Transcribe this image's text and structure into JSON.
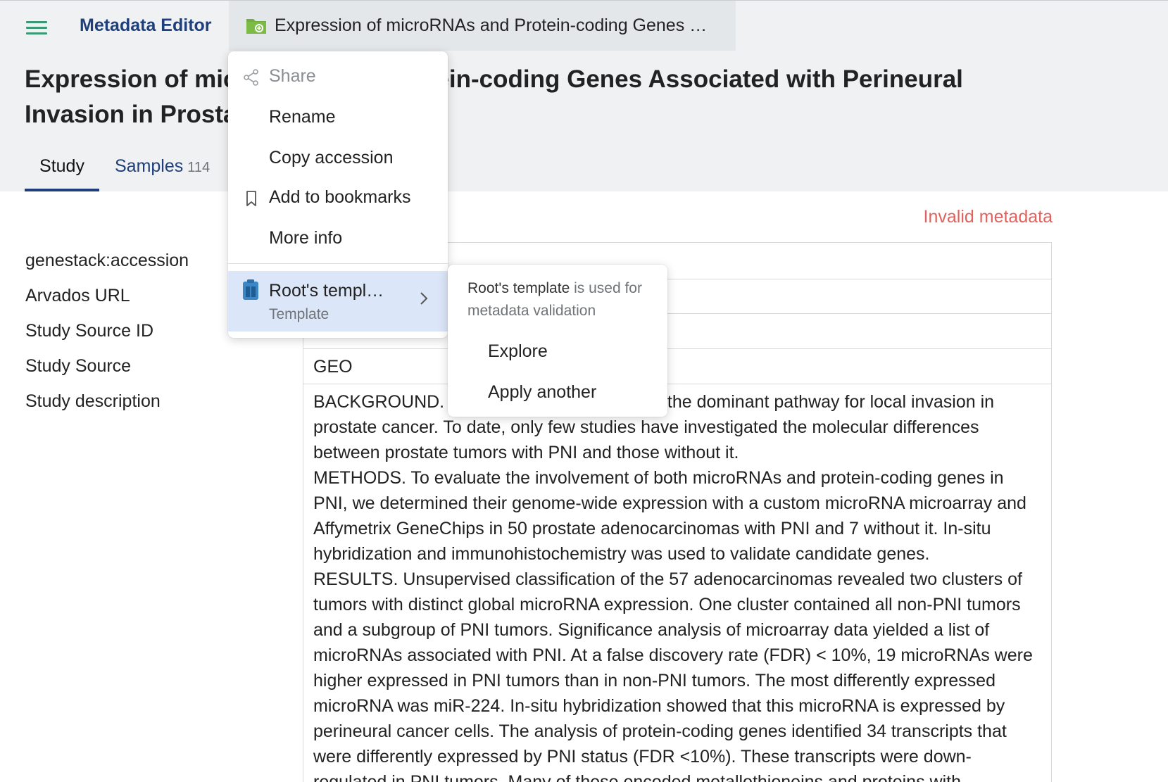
{
  "header": {
    "app_title": "Metadata Editor",
    "file_tab_label": "Expression of microRNAs and Protein-coding Genes …",
    "menu_icon": "hamburger-menu-icon",
    "file_icon": "study-folder-icon"
  },
  "page": {
    "title": "Expression of microRNAs and Protein-coding Genes Associated with Perineural Invasion in Prostate Cancer"
  },
  "tabs": [
    {
      "label": "Study",
      "active": true
    },
    {
      "label": "Samples",
      "count": "114",
      "active": false
    }
  ],
  "status": {
    "invalid_metadata": "Invalid metadata",
    "color": "#e0625e"
  },
  "fields": [
    {
      "label": "genestack:accession",
      "value": ""
    },
    {
      "label": "Arvados URL",
      "value": ""
    },
    {
      "label": "Study Source ID",
      "value": ""
    },
    {
      "label": "Study Source",
      "value": "GEO"
    },
    {
      "label": "Study description",
      "value": "BACKGROUND. Perineural invasion (PNI) is the dominant pathway for local invasion in\nprostate cancer. To date, only few studies have investigated the molecular differences\nbetween prostate tumors with PNI and those without it.\nMETHODS. To evaluate the involvement of both microRNAs and protein-coding genes in\nPNI, we determined their genome-wide expression with a custom microRNA microarray and\nAffymetrix GeneChips in 50 prostate adenocarcinomas with PNI and 7 without it. In-situ\nhybridization and immunohistochemistry was used to validate candidate genes.\nRESULTS. Unsupervised classification of the 57 adenocarcinomas revealed two clusters of\ntumors with distinct global microRNA expression. One cluster contained all non-PNI tumors\nand a subgroup of PNI tumors. Significance analysis of microarray data yielded a list of\nmicroRNAs associated with PNI. At a false discovery rate (FDR) < 10%, 19 microRNAs were\nhigher expressed in PNI tumors than in non-PNI tumors. The most differently expressed\nmicroRNA was miR-224. In-situ hybridization showed that this microRNA is expressed by\nperineural cancer cells. The analysis of protein-coding genes identified 34 transcripts that\nwere differently expressed by PNI status (FDR <10%). These transcripts were down-\nregulated in PNI tumors. Many of these encoded metallothioneins and proteins with"
    }
  ],
  "context_menu": {
    "items": [
      {
        "label": "Share",
        "icon": "share-icon",
        "disabled": true
      },
      {
        "label": "Rename",
        "icon": "",
        "disabled": false
      },
      {
        "label": "Copy accession",
        "icon": "",
        "disabled": false
      },
      {
        "label": "Add to bookmarks",
        "icon": "bookmark-icon",
        "disabled": false
      },
      {
        "label": "More info",
        "icon": "",
        "disabled": false
      }
    ],
    "template": {
      "name": "Root's templ…",
      "subtitle": "Template",
      "icon": "template-icon"
    }
  },
  "submenu": {
    "info_strong": "Root's template",
    "info_rest": " is used for metadata validation",
    "items": [
      "Explore",
      "Apply another"
    ]
  },
  "colors": {
    "brand": "#1e3f7a",
    "menu_icon": "#3a9a74",
    "selected_menu": "#dbe6f8"
  }
}
